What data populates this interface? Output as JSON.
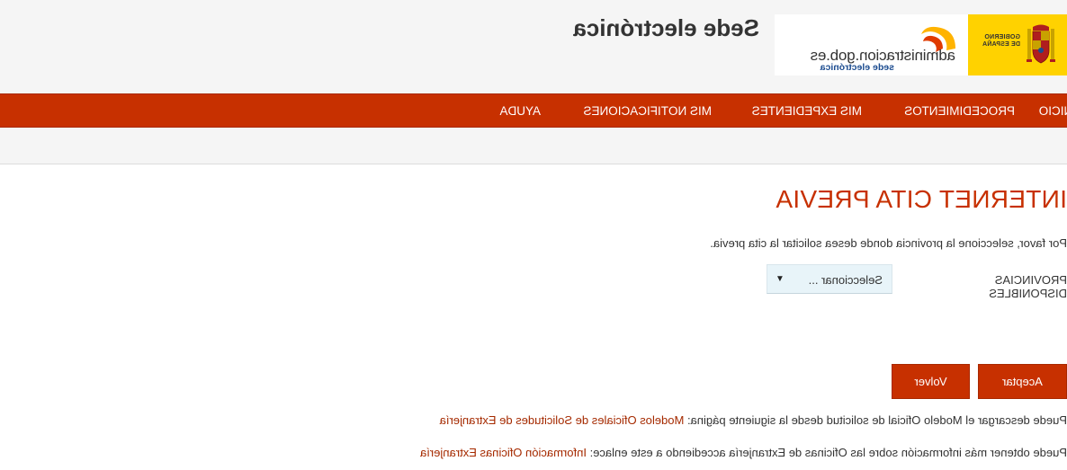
{
  "header": {
    "site_title": "Sede electrónica",
    "admin_logo_name": "administracion.gob.es",
    "admin_logo_sub": "sede electrónica",
    "gov_logo_line1": "GOBIERNO",
    "gov_logo_line2": "DE ESPAÑA"
  },
  "nav": {
    "items": [
      "INICIO",
      "PROCEDIMIENTOS",
      "MIS EXPEDIENTES",
      "MIS NOTIFICACIONES",
      "AYUDA"
    ]
  },
  "page": {
    "title": "INTERNET CITA PREVIA",
    "instructions": "Por favor, seleccione la provincia donde desea solicitar la cita previa.",
    "field_label_line1": "PROVINCIAS",
    "field_label_line2": "DISPONIBLES",
    "select_value": "Seleccionar ...",
    "accept_label": "Aceptar",
    "back_label": "Volver",
    "info1_text": "Puede descargar el Modelo Oficial de solicitud desde la siguiente página: ",
    "info1_link": "Modelos Oficiales de Solicitudes de Extranjería",
    "info2_text": "Puede obtener más información sobre las Oficinas de Extranjería accediendo a este enlace: ",
    "info2_link": "Información Oficinas Extranjería"
  },
  "colors": {
    "brand_red": "#c73000",
    "link_red": "#a52a00",
    "gov_yellow": "#ffd200",
    "header_bg": "#f5f5f5",
    "select_bg": "#e8f4f9"
  }
}
